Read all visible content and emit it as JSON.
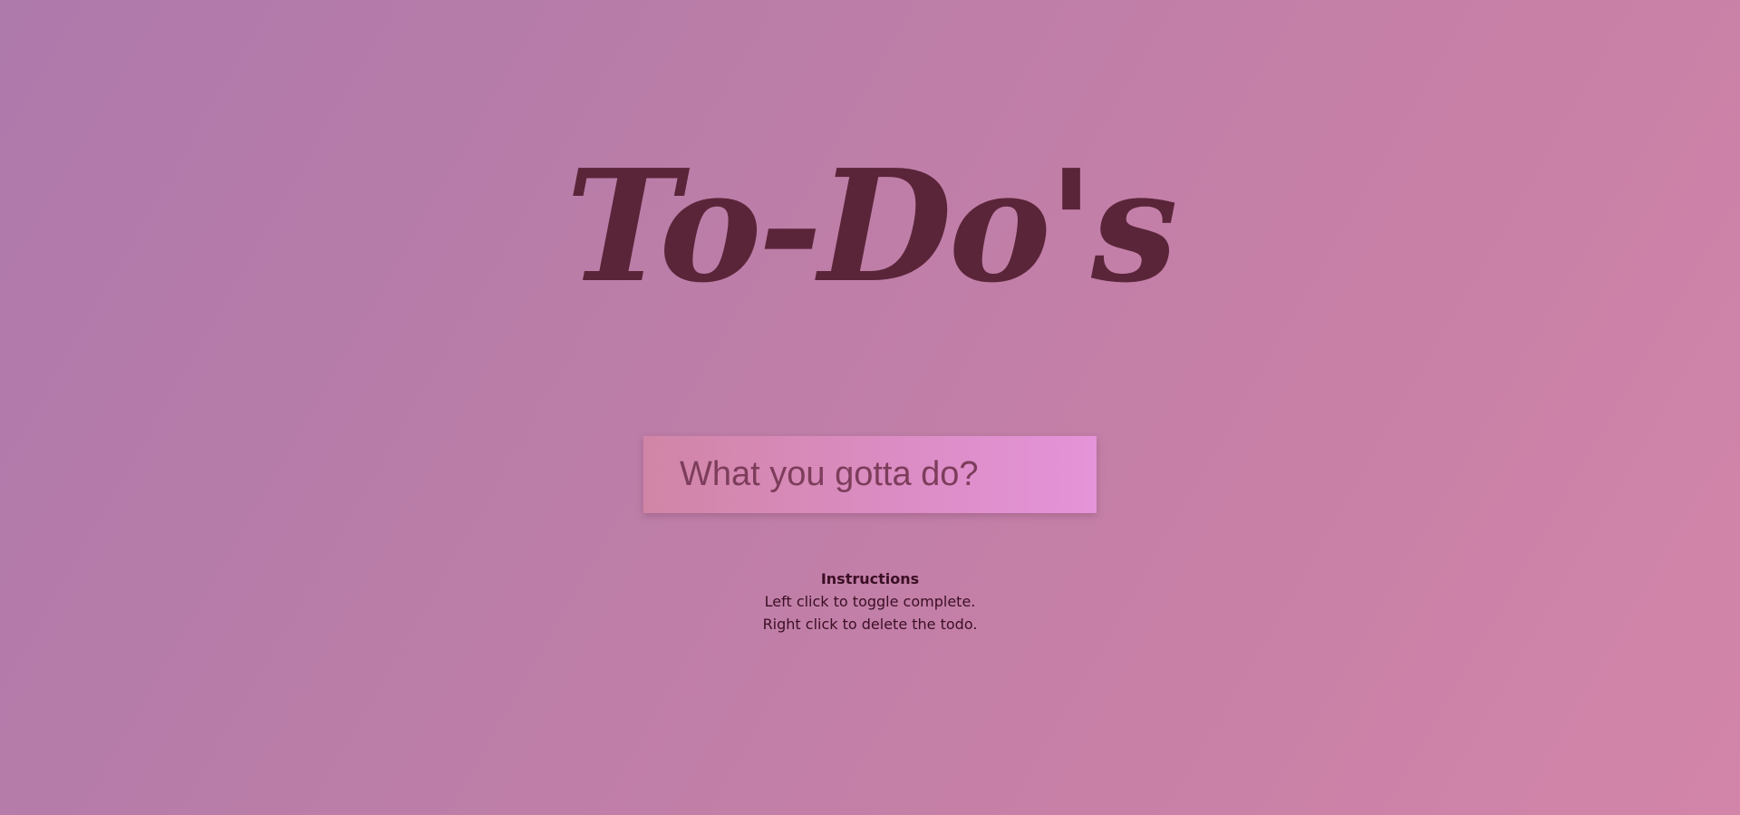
{
  "header": {
    "title": "To-Do's"
  },
  "todo_input": {
    "placeholder": "What you gotta do?",
    "value": ""
  },
  "instructions": {
    "heading": "Instructions",
    "line1": "Left click to toggle complete.",
    "line2": "Right click to delete the todo."
  },
  "colors": {
    "title": "#5b2539",
    "text": "#3b0f24",
    "background_start": "#ae79ab",
    "background_end": "#d285a8"
  }
}
